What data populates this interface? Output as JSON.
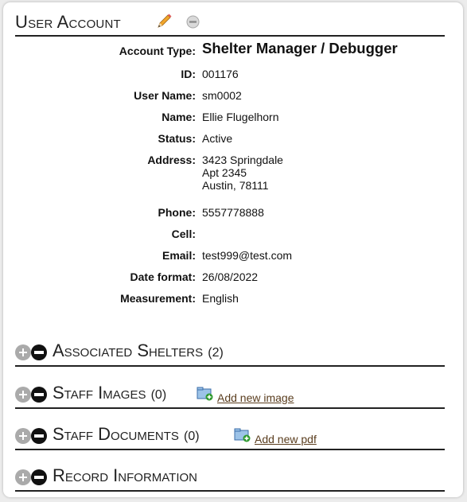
{
  "header": {
    "title": "User Account"
  },
  "fields": [
    {
      "label": "Account Type:",
      "value": "Shelter Manager / Debugger"
    },
    {
      "label": "ID:",
      "value": "001176"
    },
    {
      "label": "User Name:",
      "value": "sm0002"
    },
    {
      "label": "Name:",
      "value": "Ellie Flugelhorn"
    },
    {
      "label": "Status:",
      "value": "Active"
    },
    {
      "label": "Address:",
      "value": "3423 Springdale\nApt 2345\nAustin, 78111"
    },
    {
      "label": "Phone:",
      "value": "5557778888"
    },
    {
      "label": "Cell:",
      "value": ""
    },
    {
      "label": "Email:",
      "value": "test999@test.com"
    },
    {
      "label": "Date format:",
      "value": "26/08/2022"
    },
    {
      "label": "Measurement:",
      "value": "English"
    }
  ],
  "sections": {
    "shelters": {
      "title": "Associated Shelters",
      "count": "(2)"
    },
    "images": {
      "title": "Staff Images",
      "count": "(0)",
      "link": "Add new image"
    },
    "documents": {
      "title": "Staff Documents",
      "count": "(0)",
      "link": "Add new pdf"
    },
    "record": {
      "title": "Record Information"
    }
  },
  "icons": {
    "edit": "pencil-icon",
    "remove": "minus-circle-icon",
    "add_file": "folder-add-icon",
    "expand": "plus-circle-icon",
    "collapse": "minus-circle-icon"
  },
  "colors": {
    "link": "#5a3d1e",
    "header_rule": "#222222"
  }
}
